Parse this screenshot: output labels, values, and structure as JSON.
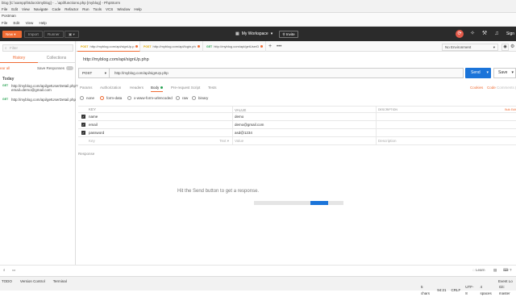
{
  "ide": {
    "title": "blog [C:\\xampp\\htdocs\\myblog] - ...\\api\\functions.php [myblog] - PhpStorm",
    "menu": [
      "File",
      "Edit",
      "View",
      "Navigate",
      "Code",
      "Refactor",
      "Run",
      "Tools",
      "VCS",
      "Window",
      "Help"
    ],
    "footer_left": [
      "TODO",
      "Version Control",
      "Terminal"
    ],
    "footer_right": [
      "5 chars",
      "94:21",
      "CRLF",
      "UTF-8",
      "4 spaces",
      "Git: master"
    ],
    "event_log": "Event Lo"
  },
  "postman": {
    "title": "Postman",
    "menu": [
      "File",
      "Edit",
      "View",
      "Help"
    ],
    "header": {
      "new": "New",
      "import": "Import",
      "runner": "Runner",
      "workspace": "My Workspace",
      "invite": "Invite",
      "signin": "Sign"
    },
    "sidebar": {
      "filter_placeholder": "Filter",
      "tab_history": "History",
      "tab_collections": "Collections",
      "clear_all": "ear all",
      "save_responses": "Save Responses",
      "today": "Today",
      "history": [
        {
          "method": "GET",
          "url": "http://myblog.com/api/getUserDetail.php?email=demo@gmail.com"
        },
        {
          "method": "GET",
          "url": "http://myblog.com/api/getUserDetail.php"
        }
      ]
    },
    "tabs": [
      {
        "method": "POST",
        "url": "http://myblog.com/api/signUp.p"
      },
      {
        "method": "POST",
        "url": "http://myblog.com/api/login.ph"
      },
      {
        "method": "GET",
        "url": "http://myblog.com/api/getUserD"
      }
    ],
    "environment": "No Environment",
    "request_title": "http://myblog.com/api/signUp.php",
    "method": "POST",
    "url": "http://myblog.com/api/signUp.php",
    "send": "Send",
    "save": "Save",
    "subtabs": [
      "Params",
      "Authorization",
      "Headers",
      "Body",
      "Pre-request Script",
      "Tests"
    ],
    "cookies": "Cookies",
    "code": "Code",
    "comments": "Comments (0)",
    "body_types": [
      "none",
      "form-data",
      "x-www-form-urlencoded",
      "raw",
      "binary"
    ],
    "table": {
      "headers": {
        "key": "KEY",
        "value": "VALUE",
        "description": "DESCRIPTION",
        "bulk": "Bulk Edit"
      },
      "rows": [
        {
          "key": "name",
          "value": "demo"
        },
        {
          "key": "email",
          "value": "demo@gmail.com"
        },
        {
          "key": "password",
          "value": "asd@1234"
        }
      ],
      "placeholder": {
        "key": "Key",
        "type": "Text",
        "value": "Value",
        "description": "Description"
      }
    },
    "response_label": "Response",
    "hint": "Hit the Send button to get a response.",
    "footer_learn": "Learn"
  }
}
